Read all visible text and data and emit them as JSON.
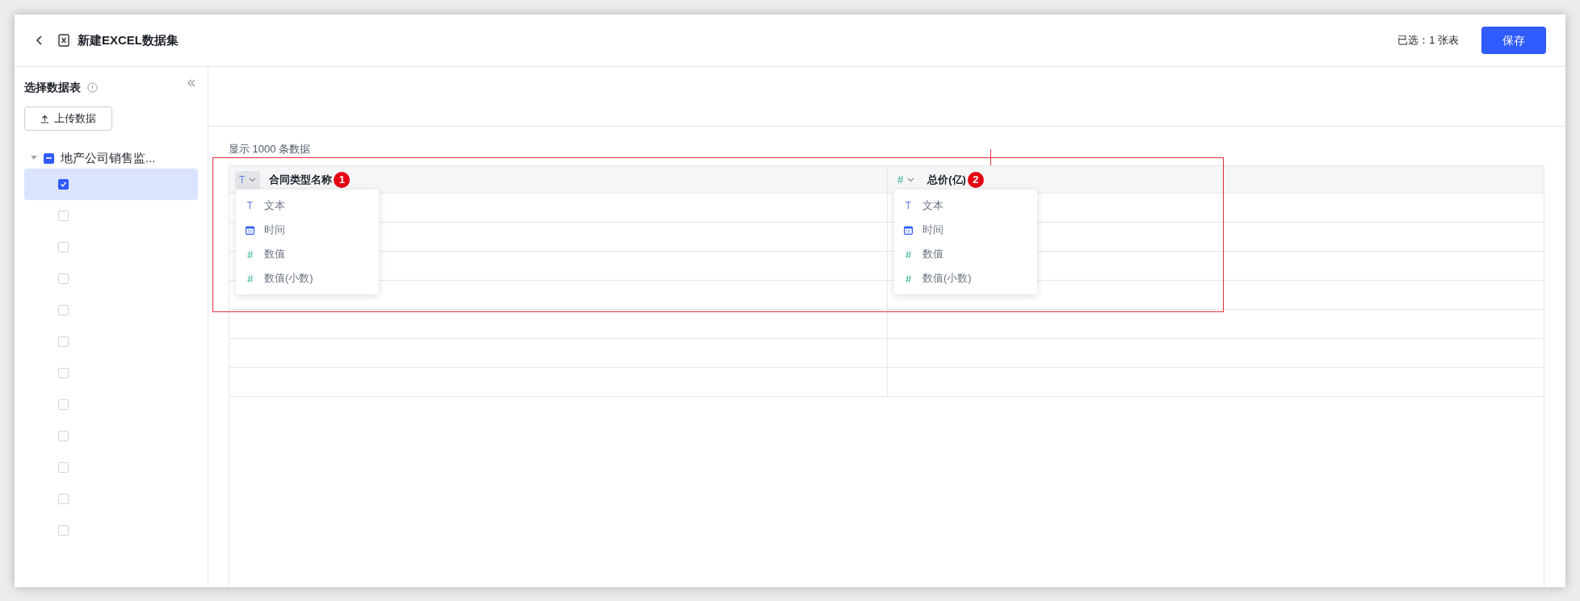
{
  "header": {
    "title": "新建EXCEL数据集",
    "selection_summary": "已选：1 张表",
    "save_button": "保存"
  },
  "sidebar": {
    "title": "选择数据表",
    "upload_button": "上传数据",
    "tree": [
      {
        "label": "地产公司销售监...",
        "expanded": true,
        "indeterminate": true,
        "children": [
          {
            "checked": true,
            "selected": true
          },
          {
            "checked": false,
            "selected": false
          },
          {
            "checked": false,
            "selected": false
          },
          {
            "checked": false,
            "selected": false
          },
          {
            "checked": false,
            "selected": false
          },
          {
            "checked": false,
            "selected": false
          },
          {
            "checked": false,
            "selected": false
          },
          {
            "checked": false,
            "selected": false
          },
          {
            "checked": false,
            "selected": false
          },
          {
            "checked": false,
            "selected": false
          },
          {
            "checked": false,
            "selected": false
          },
          {
            "checked": false,
            "selected": false
          }
        ]
      }
    ]
  },
  "preview": {
    "row_count": "显示 1000 条数据",
    "columns": [
      {
        "name": "合同类型名称",
        "kind": "text",
        "type_icon": "T",
        "badge": "1",
        "menu_open": true,
        "type_button_active": true,
        "menu": [
          {
            "kind": "text",
            "icon": "T",
            "label": "文本"
          },
          {
            "kind": "time",
            "label": "时间"
          },
          {
            "kind": "number",
            "icon": "#",
            "label": "数值"
          },
          {
            "kind": "number",
            "icon": "#",
            "label": "数值(小数)"
          }
        ]
      },
      {
        "name": "总价(亿)",
        "kind": "number",
        "type_icon": "#",
        "badge": "2",
        "menu_open": true,
        "type_button_active": false,
        "menu": [
          {
            "kind": "text",
            "icon": "T",
            "label": "文本"
          },
          {
            "kind": "time",
            "label": "时间"
          },
          {
            "kind": "number",
            "icon": "#",
            "label": "数值"
          },
          {
            "kind": "number",
            "icon": "#",
            "label": "数值(小数)"
          }
        ]
      }
    ]
  }
}
